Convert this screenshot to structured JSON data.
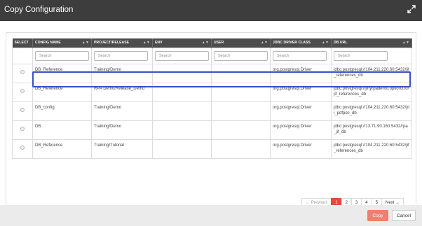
{
  "dialog": {
    "title": "Copy Configuration"
  },
  "table": {
    "columns": [
      {
        "label": "SELECT",
        "sortable": false
      },
      {
        "label": "CONFIG NAME",
        "sortable": true
      },
      {
        "label": "PROJECT/RELEASE",
        "sortable": true
      },
      {
        "label": "ENV",
        "sortable": true
      },
      {
        "label": "USER",
        "sortable": true
      },
      {
        "label": "JDBC DRIVER CLASS",
        "sortable": true
      },
      {
        "label": "DB URL",
        "sortable": true
      }
    ],
    "search_placeholder": "Search",
    "rows": [
      {
        "config_name": "DB_Reference",
        "project_release": "Training/Demo",
        "env": "",
        "user": "",
        "jdbc": "org.postgresql.Driver",
        "db_url": "jdbc:postgresql://104.211.220.60:5432/jif_references_db"
      },
      {
        "config_name": "DB_Reference",
        "project_release": "RPA Demo/Release_Demo",
        "env": "",
        "user": "",
        "jdbc": "org.postgresql.Driver",
        "db_url": "jdbc:postgresql://jiffyrpademo.option3.io/jif_references_db"
      },
      {
        "config_name": "DB_config",
        "project_release": "Training/Demo",
        "env": "",
        "user": "",
        "jdbc": "org.postgresql.Driver",
        "db_url": "jdbc:postgresql://104.211.220.60:5432/jdi_pdfpoc_db"
      },
      {
        "config_name": "DB",
        "project_release": "Training/Demo",
        "env": "",
        "user": "",
        "jdbc": "org.postgresql.Driver",
        "db_url": "jdbc:postgresql://13.71.90.160:5432/rpa_jif_db"
      },
      {
        "config_name": "DB_Reference",
        "project_release": "Training/Tutorial",
        "env": "",
        "user": "",
        "jdbc": "org.postgresql.Driver",
        "db_url": "jdbc:postgresql://104.211.220.60:5432/jif_references_db"
      }
    ]
  },
  "pagination": {
    "previous_label": "← Previous",
    "next_label": "Next →",
    "pages": [
      "1",
      "2",
      "3",
      "4",
      "5"
    ],
    "current_page": "1"
  },
  "footer": {
    "copy_label": "Copy",
    "cancel_label": "Cancel"
  },
  "colors": {
    "header_bg": "#3d3d3d",
    "table_header_bg": "#4c4c4c",
    "accent": "#e54b3c",
    "copy_button": "#ef7f6f",
    "search_highlight": "#3b4fc4"
  },
  "icons": {
    "expand": "expand-icon",
    "sort": "sort-icon",
    "radio": "radio-icon"
  }
}
